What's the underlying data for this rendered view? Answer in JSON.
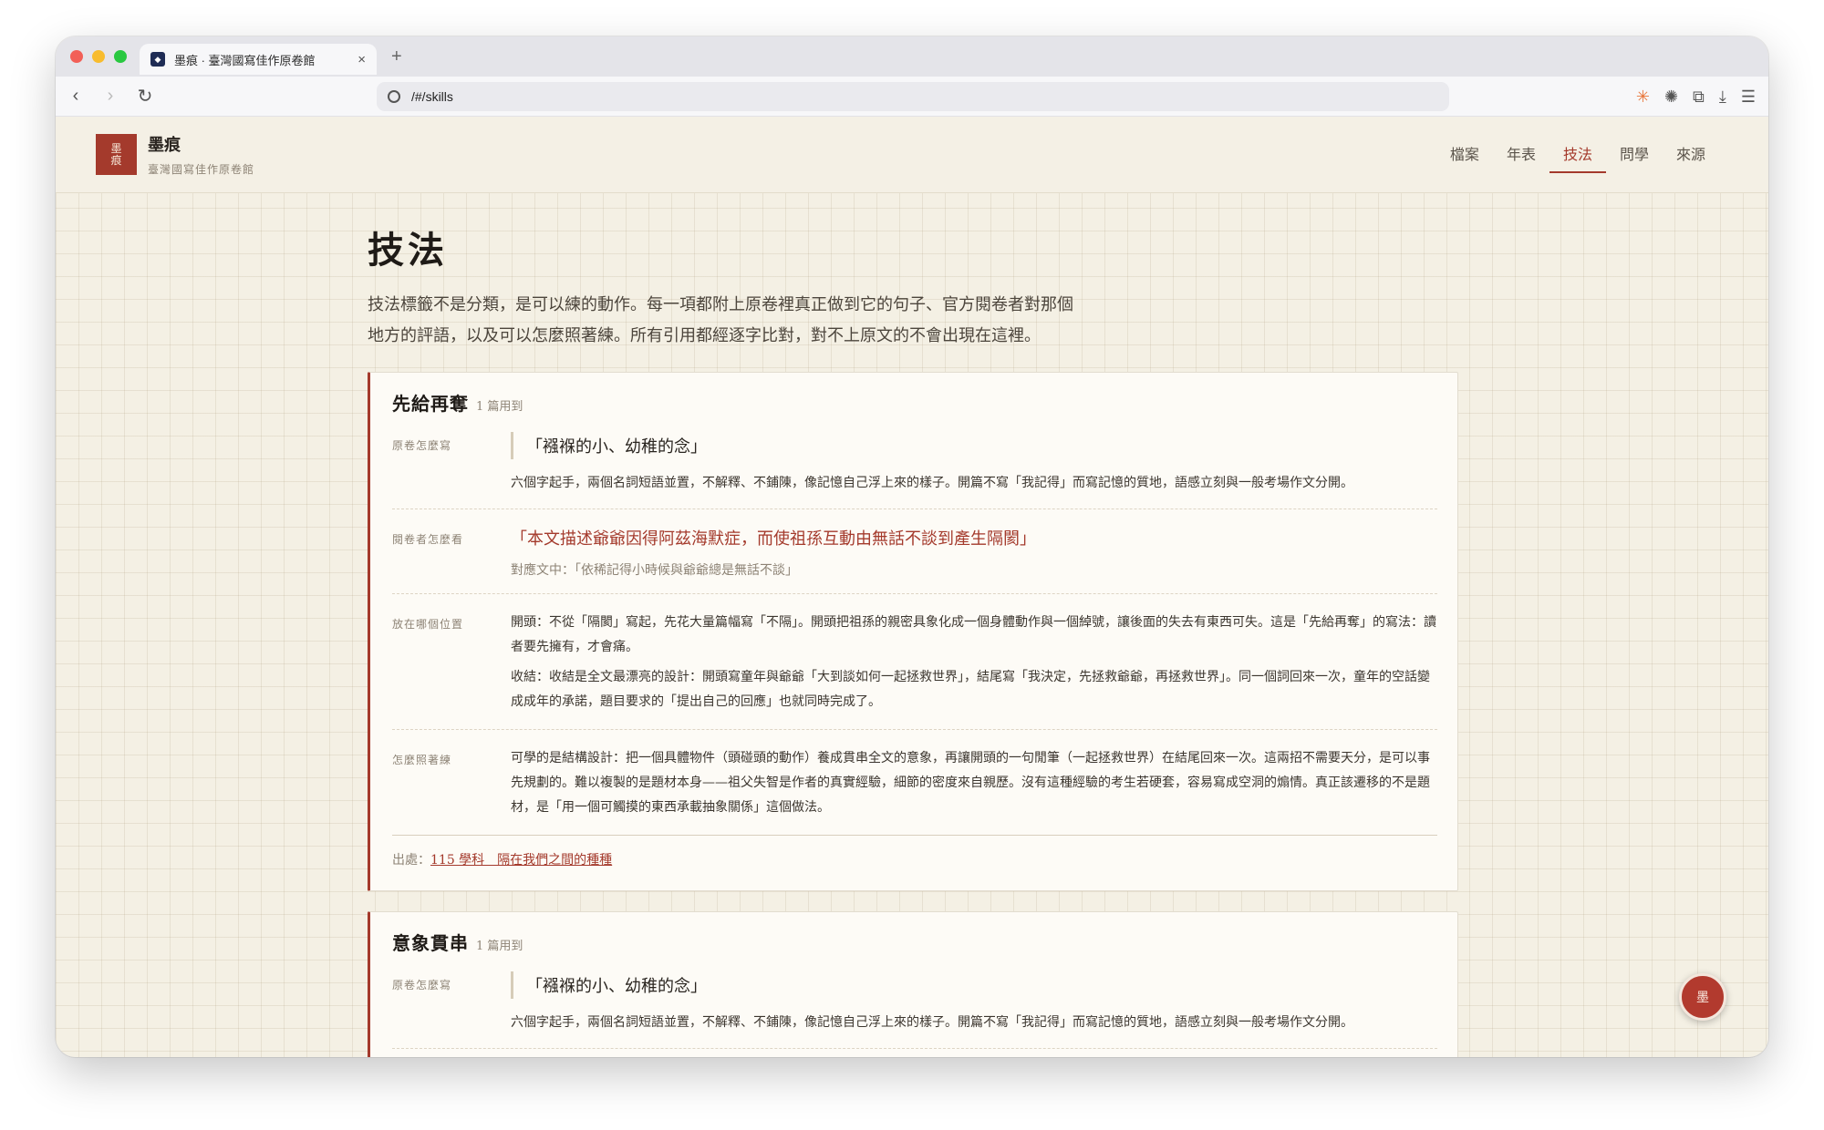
{
  "browser": {
    "tab_title": "墨痕 · 臺灣國寫佳作原卷館",
    "tab_close": "×",
    "new_tab": "+",
    "url": "/#/skills",
    "back": "‹",
    "forward": "›",
    "reload": "↻"
  },
  "site": {
    "logo": [
      "墨",
      "痕"
    ],
    "name": "墨痕",
    "subtitle": "臺灣國寫佳作原卷館",
    "nav": [
      {
        "label": "檔案"
      },
      {
        "label": "年表"
      },
      {
        "label": "技法"
      },
      {
        "label": "問學"
      },
      {
        "label": "來源"
      }
    ]
  },
  "page": {
    "title": "技法",
    "intro": "技法標籤不是分類，是可以練的動作。每一項都附上原卷裡真正做到它的句子、官方閱卷者對那個地方的評語，以及可以怎麼照著練。所有引用都經逐字比對，對不上原文的不會出現在這裡。"
  },
  "cards": [
    {
      "title": "先給再奪",
      "count": "1 篇用到",
      "rows": {
        "original_label": "原卷怎麼寫",
        "original_quote": "「襁褓的小、幼稚的念」",
        "original_note": "六個字起手，兩個名詞短語並置，不解釋、不鋪陳，像記憶自己浮上來的樣子。開篇不寫「我記得」而寫記憶的質地，語感立刻與一般考場作文分開。",
        "grader_label": "閱卷者怎麼看",
        "grader_quote": "「本文描述爺爺因得阿茲海默症，而使祖孫互動由無話不談到產生隔閡」",
        "grader_ref": "對應文中：「依稀記得小時候與爺爺總是無話不談」",
        "position_label": "放在哪個位置",
        "position_p1": "開頭：不從「隔閡」寫起，先花大量篇幅寫「不隔」。開頭把祖孫的親密具象化成一個身體動作與一個綽號，讓後面的失去有東西可失。這是「先給再奪」的寫法：讀者要先擁有，才會痛。",
        "position_p2": "收結：收結是全文最漂亮的設計：開頭寫童年與爺爺「大到談如何一起拯救世界」，結尾寫「我決定，先拯救爺爺，再拯救世界」。同一個詞回來一次，童年的空話變成成年的承諾，題目要求的「提出自己的回應」也就同時完成了。",
        "practice_label": "怎麼照著練",
        "practice": "可學的是結構設計：把一個具體物件（頭碰頭的動作）養成貫串全文的意象，再讓開頭的一句閒筆（一起拯救世界）在結尾回來一次。這兩招不需要天分，是可以事先規劃的。難以複製的是題材本身——祖父失智是作者的真實經驗，細節的密度來自親歷。沒有這種經驗的考生若硬套，容易寫成空洞的煽情。真正該遷移的不是題材，是「用一個可觸摸的東西承載抽象關係」這個做法。"
      },
      "source_prefix": "出處：",
      "source_link": "115 學科　隔在我們之間的種種"
    },
    {
      "title": "意象貫串",
      "count": "1 篇用到",
      "rows": {
        "original_label": "原卷怎麼寫",
        "original_quote": "「襁褓的小、幼稚的念」",
        "original_note": "六個字起手，兩個名詞短語並置，不解釋、不鋪陳，像記憶自己浮上來的樣子。開篇不寫「我記得」而寫記憶的質地，語感立刻與一般考場作文分開。"
      }
    }
  ],
  "float_seal": "墨"
}
